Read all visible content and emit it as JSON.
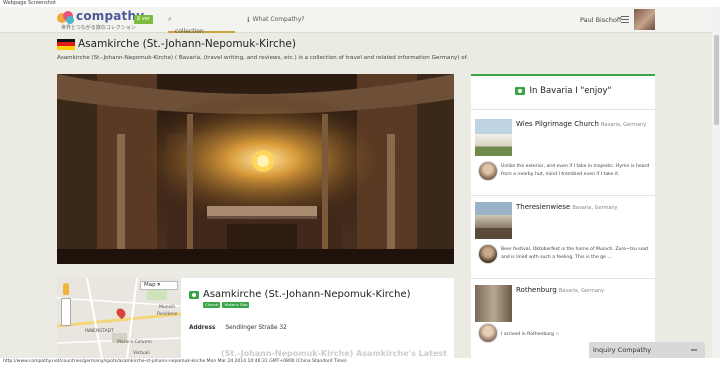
{
  "page": {
    "label": "Webpage Screenshot"
  },
  "header": {
    "logo": "compathy",
    "tagline": "世界とつながる旅のコレクション",
    "beta": "β ver",
    "nav": [
      {
        "label": "Look for a collection"
      },
      {
        "label": "What Compathy?"
      }
    ],
    "user_name": "Paul Bischoff"
  },
  "title": {
    "name": "Asamkirche (St.-Johann-Nepomuk-Kirche)",
    "description": "Asamkirche (St.-Johann-Nepomuk-Kirche) ( Bavaria, (travel writing, and reviews, etc.) is a collection of travel and related information Germany) of."
  },
  "colors": {
    "flag": [
      "#111111",
      "#dd1c1a",
      "#ffce00"
    ],
    "accent": "#3aa548"
  },
  "map": {
    "type_button": "Map",
    "labels": [
      "Munich",
      "Residenz",
      "INNENSTADT",
      "Marie's Column",
      "Viktuali"
    ]
  },
  "info": {
    "name": "Asamkirche (St.-Johann-Nepomuk-Kirche)",
    "tags": [
      "Church",
      "Historic Site"
    ],
    "address_label": "Address",
    "address_value": "Sendlinger Straße 32",
    "cutoff_heading": "(St.-Johann-Nepomuk-Kirche) Asamkirche's Latest"
  },
  "sidebar": {
    "title": "In Bavaria I \"enjoy\"",
    "spots": [
      {
        "name": "Wies Pilgrimage Church",
        "location": "Bavaria, Germany",
        "comment": "Unlike the exterior, and even if I take in majestic. Hymn is heard from a nearby hut, mind I trembled even if I take it."
      },
      {
        "name": "Theresienwiese",
        "location": "Bavaria, Germany",
        "comment": "Beer festival, Oktoberfest is the home of Munich. Zure~tsu seat and is lined with such a feeling. This is the ge ..."
      },
      {
        "name": "Rothenburg",
        "location": "Bavaria, Germany",
        "comment": "I arrived in Rothenburg ☆"
      }
    ]
  },
  "inquiry": {
    "label": "Inquiry Compathy"
  },
  "status": {
    "text": "http://www.compathy.net/countries/germany/spots/asamkirche-st-johann-nepomuk-kirche Mon Mar 24 2014 10:46:31 GMT+0800 (China Standard Time)"
  }
}
